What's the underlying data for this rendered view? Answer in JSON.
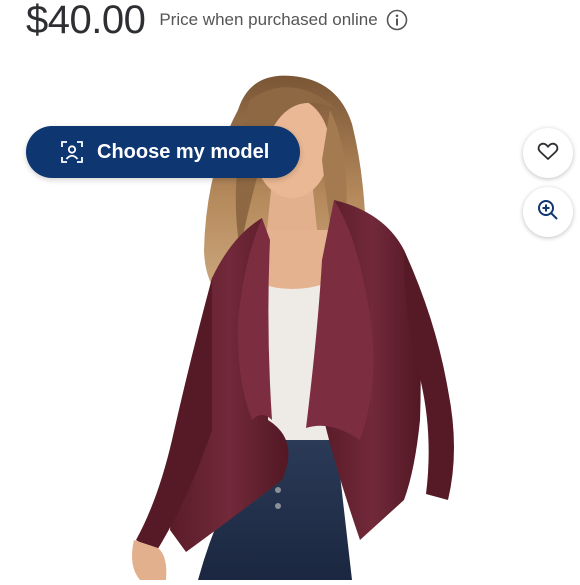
{
  "price": {
    "amount": "$40.00",
    "note": "Price when purchased online"
  },
  "model_button": {
    "label": "Choose my model"
  },
  "icons": {
    "info": "info-icon",
    "scan": "person-scan-icon",
    "favorite": "heart-icon",
    "zoom": "zoom-in-icon"
  },
  "colors": {
    "price_text": "#2e2f32",
    "button_bg": "#0e3671",
    "jacket": "#6a2431",
    "zoom_icon": "#0e3671"
  }
}
